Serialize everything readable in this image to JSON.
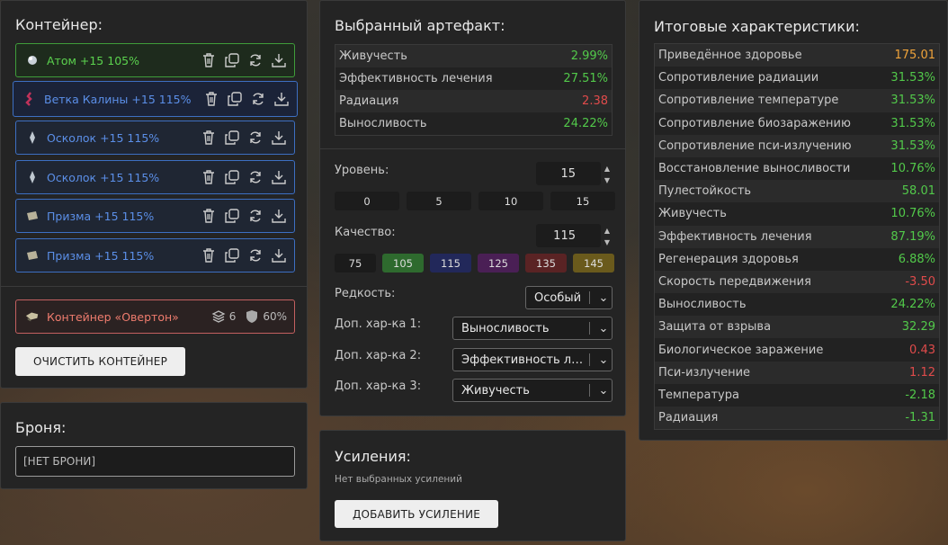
{
  "container": {
    "title": "Контейнер:",
    "artifacts": [
      {
        "name": "Атом +15 105%",
        "style": "green"
      },
      {
        "name": "Ветка Калины +15 115%",
        "style": "selected"
      },
      {
        "name": "Осколок +15 115%",
        "style": "blue"
      },
      {
        "name": "Осколок +15 115%",
        "style": "blue"
      },
      {
        "name": "Призма +15 115%",
        "style": "blue"
      },
      {
        "name": "Призма +15 115%",
        "style": "blue"
      }
    ],
    "container_item": {
      "name": "Контейнер «Овертон»",
      "slots": "6",
      "protection": "60%"
    },
    "clear_button": "ОЧИСТИТЬ КОНТЕЙНЕР"
  },
  "armor": {
    "title": "Броня:",
    "value": "[НЕТ БРОНИ]"
  },
  "selected": {
    "title": "Выбранный артефакт:",
    "stats": [
      {
        "label": "Живучесть",
        "value": "2.99%",
        "color": "green"
      },
      {
        "label": "Эффективность лечения",
        "value": "27.51%",
        "color": "green"
      },
      {
        "label": "Радиация",
        "value": "2.38",
        "color": "red"
      },
      {
        "label": "Выносливость",
        "value": "24.22%",
        "color": "green"
      }
    ],
    "level_label": "Уровень:",
    "level_value": "15",
    "level_presets": [
      "0",
      "5",
      "10",
      "15"
    ],
    "quality_label": "Качество:",
    "quality_value": "115",
    "quality_presets": [
      {
        "label": "75",
        "color": "#1b1b1b"
      },
      {
        "label": "105",
        "color": "#2e6a2e"
      },
      {
        "label": "115",
        "color": "#22285a"
      },
      {
        "label": "125",
        "color": "#4a1f55"
      },
      {
        "label": "135",
        "color": "#5a2324"
      },
      {
        "label": "145",
        "color": "#6a5a1c"
      }
    ],
    "rarity_label": "Редкость:",
    "rarity_value": "Особый",
    "extra1_label": "Доп. хар-ка 1:",
    "extra1_value": "Выносливость",
    "extra2_label": "Доп. хар-ка 2:",
    "extra2_value": "Эффективность ле...",
    "extra3_label": "Доп. хар-ка 3:",
    "extra3_value": "Живучесть"
  },
  "boosts": {
    "title": "Усиления:",
    "empty_note": "Нет выбранных усилений",
    "add_button": "ДОБАВИТЬ УСИЛЕНИЕ"
  },
  "totals": {
    "title": "Итоговые характеристики:",
    "stats": [
      {
        "label": "Приведённое здоровье",
        "value": "175.01",
        "color": "orange"
      },
      {
        "label": "Сопротивление радиации",
        "value": "31.53%",
        "color": "green"
      },
      {
        "label": "Сопротивление температуре",
        "value": "31.53%",
        "color": "green"
      },
      {
        "label": "Сопротивление биозаражению",
        "value": "31.53%",
        "color": "green"
      },
      {
        "label": "Сопротивление пси-излучению",
        "value": "31.53%",
        "color": "green"
      },
      {
        "label": "Восстановление выносливости",
        "value": "10.76%",
        "color": "green"
      },
      {
        "label": "Пулестойкость",
        "value": "58.01",
        "color": "green"
      },
      {
        "label": "Живучесть",
        "value": "10.76%",
        "color": "green"
      },
      {
        "label": "Эффективность лечения",
        "value": "87.19%",
        "color": "green"
      },
      {
        "label": "Регенерация здоровья",
        "value": "6.88%",
        "color": "green"
      },
      {
        "label": "Скорость передвижения",
        "value": "-3.50",
        "color": "red"
      },
      {
        "label": "Выносливость",
        "value": "24.22%",
        "color": "green"
      },
      {
        "label": "Защита от взрыва",
        "value": "32.29",
        "color": "green"
      },
      {
        "label": "Биологическое заражение",
        "value": "0.43",
        "color": "red"
      },
      {
        "label": "Пси-излучение",
        "value": "1.12",
        "color": "red"
      },
      {
        "label": "Температура",
        "value": "-2.18",
        "color": "green"
      },
      {
        "label": "Радиация",
        "value": "-1.31",
        "color": "green"
      }
    ]
  },
  "colors": {
    "green": "#52c94a",
    "red": "#e04b4b",
    "orange": "#f0a33a",
    "blue": "#5b8fe8"
  }
}
